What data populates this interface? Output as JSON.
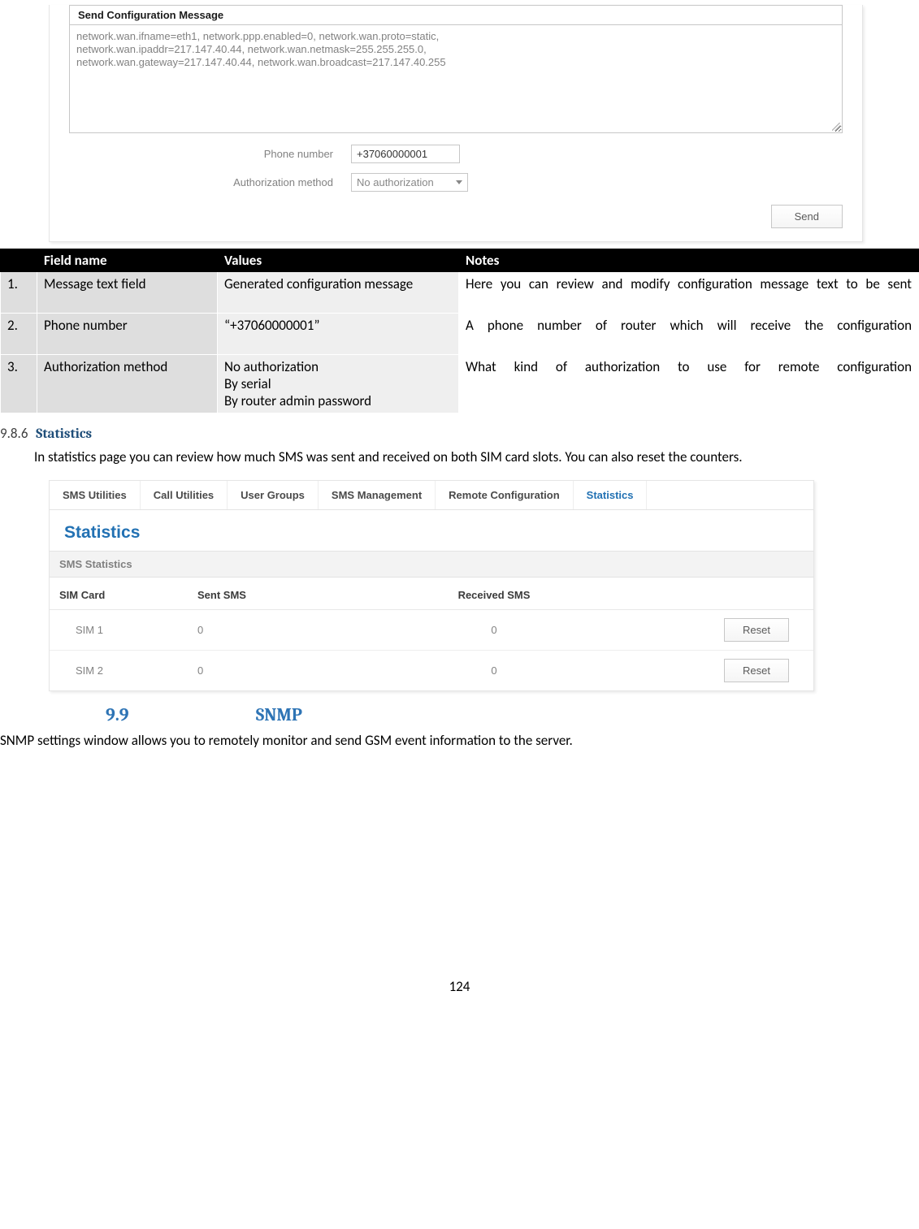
{
  "config_shot": {
    "title": "Send Configuration Message",
    "textarea_lines": [
      "network.wan.ifname=eth1, network.ppp.enabled=0, network.wan.proto=static,",
      "network.wan.ipaddr=217.147.40.44, network.wan.netmask=255.255.255.0,",
      "network.wan.gateway=217.147.40.44, network.wan.broadcast=217.147.40.255"
    ],
    "phone_label": "Phone number",
    "phone_value": "+37060000001",
    "auth_label": "Authorization method",
    "auth_value": "No authorization",
    "send_button": "Send"
  },
  "param_table": {
    "headers": {
      "num": "",
      "field": "Field name",
      "values": "Values",
      "notes": "Notes"
    },
    "rows": [
      {
        "n": "1.",
        "field": "Message text field",
        "values": "Generated configuration message",
        "notes": "Here you can review and modify configuration message text to be sent"
      },
      {
        "n": "2.",
        "field": "Phone number",
        "values": "“+37060000001”",
        "notes": "A phone number of router which will receive the configuration"
      },
      {
        "n": "3.",
        "field": "Authorization method",
        "values": "No authorization\nBy serial\nBy router admin password",
        "notes": "What kind of authorization to use for remote configuration"
      }
    ]
  },
  "sec_9_8_6": {
    "num": "9.8.6",
    "title": "Statistics"
  },
  "stats_intro": "In statistics page you can review how much SMS was sent and received on both SIM card slots. You can also reset the counters.",
  "stats_shot": {
    "tabs": [
      "SMS Utilities",
      "Call Utilities",
      "User Groups",
      "SMS Management",
      "Remote Configuration",
      "Statistics"
    ],
    "active_tab_index": 5,
    "panel_title": "Statistics",
    "subheader": "SMS Statistics",
    "columns": {
      "sim": "SIM Card",
      "sent": "Sent SMS",
      "recv": "Received SMS"
    },
    "rows": [
      {
        "sim": "SIM 1",
        "sent": "0",
        "recv": "0",
        "reset": "Reset"
      },
      {
        "sim": "SIM 2",
        "sent": "0",
        "recv": "0",
        "reset": "Reset"
      }
    ]
  },
  "sec_9_9": {
    "num": "9.9",
    "title": "SNMP"
  },
  "snmp_intro": "SNMP settings window allows you to remotely monitor and send GSM event information to the server.",
  "page_number": "124"
}
